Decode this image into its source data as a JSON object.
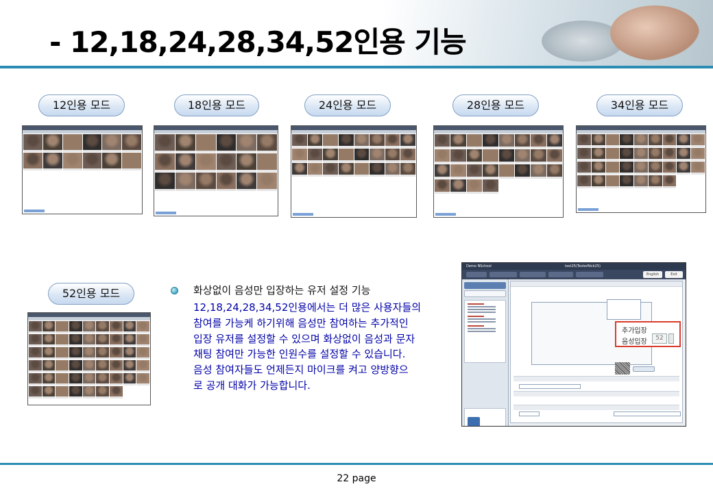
{
  "title": "- 12,18,24,28,34,52인용 기능",
  "modes": [
    {
      "label": "12인용 모드"
    },
    {
      "label": "18인용 모드"
    },
    {
      "label": "24인용 모드"
    },
    {
      "label": "28인용 모드"
    },
    {
      "label": "34인용 모드"
    },
    {
      "label": "52인용 모드"
    }
  ],
  "feature": {
    "title": "화상없이 음성만 입장하는 유저 설정 기능",
    "body_lines": [
      "12,18,24,28,34,52인용에서는 더 많은 사용자들의",
      "참여를 가능케 하기위해 음성만 참여하는 추가적인",
      "입장 유저를 설정할 수 있으며 화상없이 음성과 문자",
      "채팅 참여만 가능한 인원수를 설정할 수 있습니다.",
      "음성 참여자들도 언제든지 마이크를 켜고 양방향으",
      "로 공개 대화가 가능합니다."
    ]
  },
  "app": {
    "window_title": "Demo   NSchool",
    "center_title": "test25(TesterNick25)",
    "english_button": "English",
    "exit_button": "Exit",
    "callout_title": "추가입장",
    "callout_label": "음성입장",
    "callout_value": "52"
  },
  "footer": {
    "page": "22 page"
  },
  "colors": {
    "accent": "#2a8cb3",
    "body_text": "#0000a8",
    "callout_border": "#d93a2b"
  }
}
